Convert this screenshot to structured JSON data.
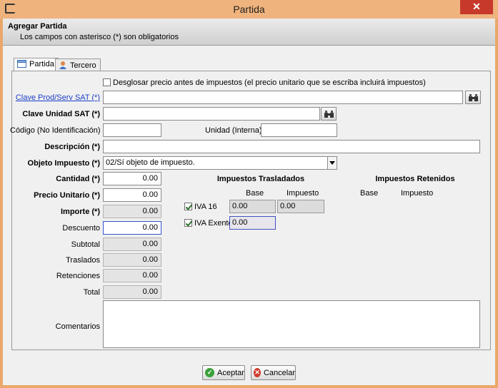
{
  "window": {
    "title": "Partida",
    "close": "✕"
  },
  "header": {
    "title": "Agregar Partida",
    "subtitle": "Los campos con asterisco (*) son obligatorios"
  },
  "tabs": [
    {
      "label": "Partida",
      "icon": "form-icon"
    },
    {
      "label": "Tercero",
      "icon": "person-icon"
    }
  ],
  "form": {
    "desglosar_label": "Desglosar precio antes de impuestos (el precio unitario que se escriba incluirá impuestos)",
    "clave_prod_label": "Clave Prod/Serv SAT (*)",
    "clave_prod_value": "",
    "clave_unidad_label": "Clave Unidad SAT (*)",
    "clave_unidad_value": "",
    "codigo_label": "Código (No Identificación)",
    "codigo_value": "",
    "unidad_label": "Unidad (Interna)",
    "unidad_value": "",
    "descripcion_label": "Descripción (*)",
    "descripcion_value": "",
    "objeto_label": "Objeto Impuesto (*)",
    "objeto_value": "02/Sí objeto de impuesto.",
    "cantidad_label": "Cantidad (*)",
    "cantidad_value": "0.00",
    "precio_label": "Precio Unitario (*)",
    "precio_value": "0.00",
    "importe_label": "Importe (*)",
    "importe_value": "0.00",
    "descuento_label": "Descuento",
    "descuento_value": "0.00",
    "subtotal_label": "Subtotal",
    "subtotal_value": "0.00",
    "traslados_label": "Traslados",
    "traslados_value": "0.00",
    "retenciones_label": "Retenciones",
    "retenciones_value": "0.00",
    "total_label": "Total",
    "total_value": "0.00",
    "comentarios_label": "Comentarios",
    "comentarios_value": ""
  },
  "taxes": {
    "trasladados_title": "Impuestos Trasladados",
    "retenidos_title": "Impuestos Retenidos",
    "base_header": "Base",
    "impuesto_header": "Impuesto",
    "iva16_label": "IVA 16",
    "iva16_base": "0.00",
    "iva16_impuesto": "0.00",
    "ivaexento_label": "IVA Exento",
    "ivaexento_base": "0.00"
  },
  "buttons": {
    "accept": "Aceptar",
    "cancel": "Cancelar"
  },
  "colors": {
    "titlebar": "#efb37d",
    "close": "#c7392b",
    "link": "#1a3ec8",
    "accept_icon": "#3aa13a",
    "cancel_icon": "#d23a2a"
  }
}
